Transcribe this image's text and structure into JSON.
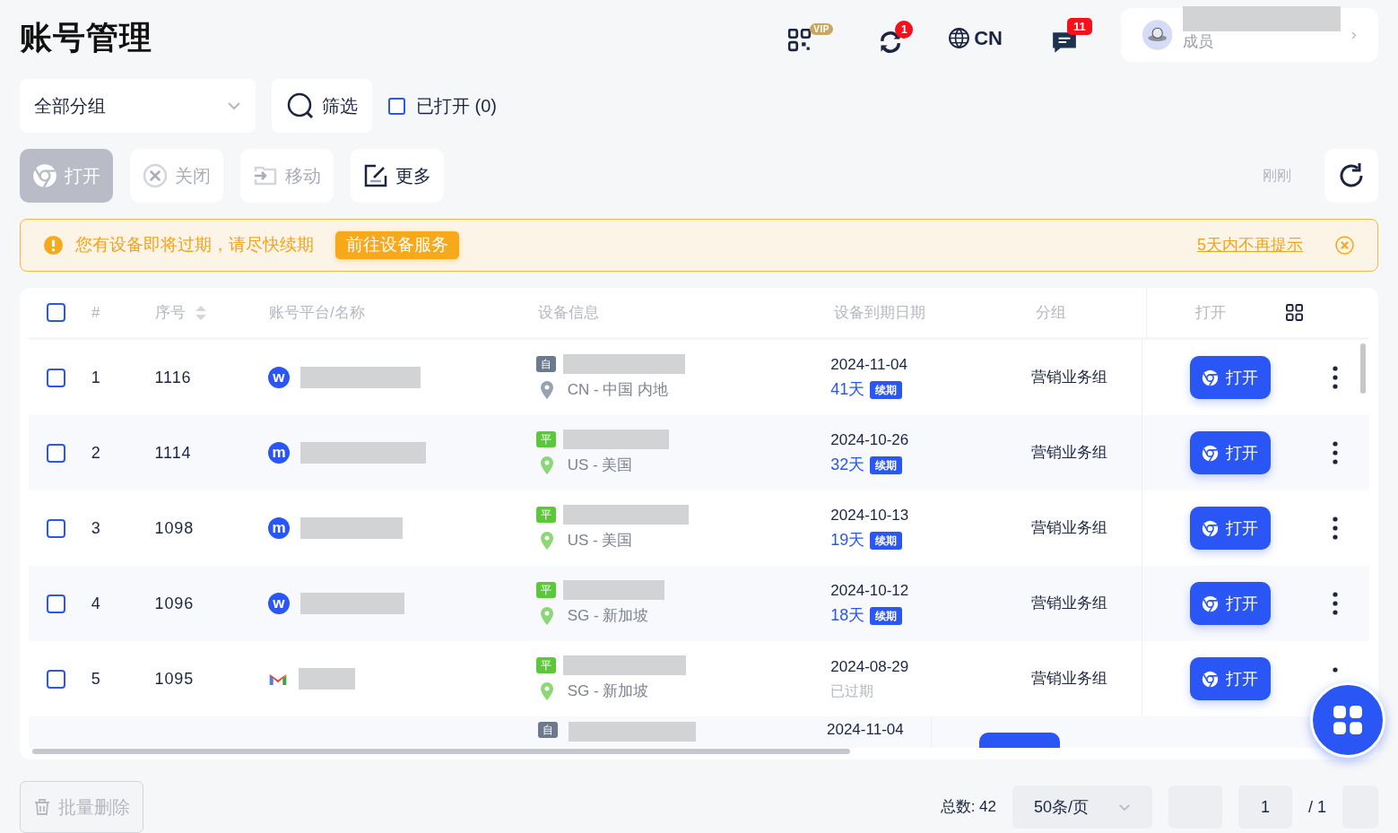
{
  "title": "账号管理",
  "header": {
    "vip_badge": "VIP",
    "sync_count": "1",
    "language": "CN",
    "message_count": "11",
    "user_role": "成员"
  },
  "toolbar": {
    "group_select": "全部分组",
    "filter": "筛选",
    "opened_filter": {
      "label": "已打开 (0)",
      "checked": false
    }
  },
  "actions": [
    {
      "kind": "open",
      "label": "打开",
      "disabled": true
    },
    {
      "kind": "close",
      "label": "关闭",
      "disabled": true
    },
    {
      "kind": "move",
      "label": "移动",
      "disabled": true
    },
    {
      "kind": "more",
      "label": "更多",
      "disabled": false
    }
  ],
  "refresh_label": "刚刚",
  "alert": {
    "message": "您有设备即将过期，请尽快续期",
    "action": "前往设备服务",
    "dismiss": "5天内不再提示"
  },
  "table": {
    "select_all": false,
    "columns": [
      "#",
      "序号",
      "账号平台/名称",
      "设备信息",
      "设备到期日期",
      "分组",
      "打开"
    ],
    "rows": [
      {
        "checked": false,
        "index": "1",
        "serial": "1116",
        "platform": {
          "kind": "letter",
          "mark": "w"
        },
        "device": {
          "badge": "自",
          "color": "#6b7a8c",
          "location": "CN - 中国 内地"
        },
        "expiry": {
          "date": "2024-11-04",
          "kind": "remaining",
          "days": "41天",
          "renew": "续期"
        },
        "group": "营销业务组",
        "open": "打开"
      },
      {
        "checked": false,
        "index": "2",
        "serial": "1114",
        "platform": {
          "kind": "letter",
          "mark": "m"
        },
        "device": {
          "badge": "平",
          "color": "#5cc73a",
          "location": "US - 美国"
        },
        "expiry": {
          "date": "2024-10-26",
          "kind": "remaining",
          "days": "32天",
          "renew": "续期"
        },
        "group": "营销业务组",
        "open": "打开"
      },
      {
        "checked": false,
        "index": "3",
        "serial": "1098",
        "platform": {
          "kind": "letter",
          "mark": "m"
        },
        "device": {
          "badge": "平",
          "color": "#5cc73a",
          "location": "US - 美国"
        },
        "expiry": {
          "date": "2024-10-13",
          "kind": "remaining",
          "days": "19天",
          "renew": "续期"
        },
        "group": "营销业务组",
        "open": "打开"
      },
      {
        "checked": false,
        "index": "4",
        "serial": "1096",
        "platform": {
          "kind": "letter",
          "mark": "w"
        },
        "device": {
          "badge": "平",
          "color": "#5cc73a",
          "location": "SG - 新加坡"
        },
        "expiry": {
          "date": "2024-10-12",
          "kind": "remaining",
          "days": "18天",
          "renew": "续期"
        },
        "group": "营销业务组",
        "open": "打开"
      },
      {
        "checked": false,
        "index": "5",
        "serial": "1095",
        "platform": {
          "kind": "mail"
        },
        "device": {
          "badge": "平",
          "color": "#5cc73a",
          "location": "SG - 新加坡"
        },
        "expiry": {
          "date": "2024-08-29",
          "kind": "expired",
          "status": "已过期"
        },
        "group": "营销业务组",
        "open": "打开"
      }
    ],
    "partial_row": {
      "badge": "自",
      "color": "#6b7a8c",
      "date": "2024-11-04"
    }
  },
  "footer": {
    "batch_delete": "批量删除",
    "total": "总数: 42",
    "page_size": "50条/页",
    "page": "1",
    "pages": "/ 1"
  }
}
